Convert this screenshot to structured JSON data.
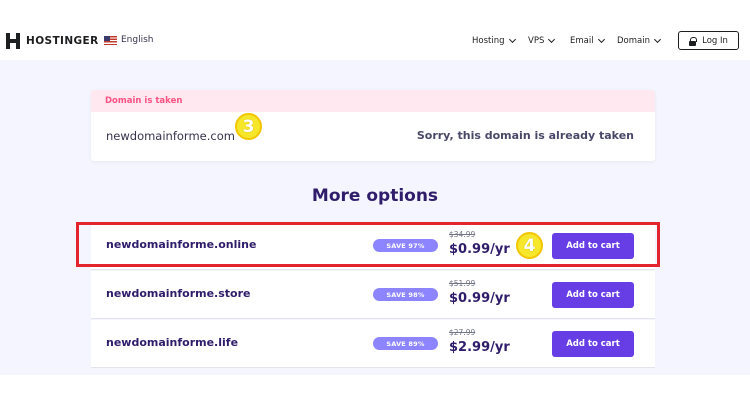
{
  "header": {
    "brand": "HOSTINGER",
    "language": "English",
    "nav": [
      "Hosting",
      "VPS",
      "Email",
      "Domain"
    ],
    "login_label": "Log In"
  },
  "taken": {
    "status": "Domain is taken",
    "domain": "newdomainforme.com",
    "message": "Sorry, this domain is already taken"
  },
  "annotations": {
    "step3": "3",
    "step4": "4"
  },
  "more_options": {
    "title": "More options",
    "items": [
      {
        "domain": "newdomainforme.online",
        "save": "SAVE 97%",
        "old_price": "$34.99",
        "price": "$0.99/yr",
        "button": "Add to cart"
      },
      {
        "domain": "newdomainforme.store",
        "save": "SAVE 98%",
        "old_price": "$51.99",
        "price": "$0.99/yr",
        "button": "Add to cart"
      },
      {
        "domain": "newdomainforme.life",
        "save": "SAVE 89%",
        "old_price": "$27.99",
        "price": "$2.99/yr",
        "button": "Add to cart"
      }
    ]
  },
  "colors": {
    "brand_purple": "#673de6",
    "dark_text": "#2f1c6a",
    "save_badge": "#8c85ff",
    "taken_pink": "#fc5185",
    "highlight_red": "#e3262d",
    "step_badge_yellow": "#f6e72a"
  },
  "icons": [
    "hostinger-logo-icon",
    "us-flag-icon",
    "chevron-down-icon",
    "lock-icon"
  ]
}
